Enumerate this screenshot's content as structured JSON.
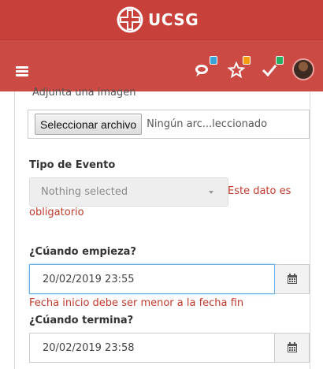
{
  "header": {
    "brand": "UCSG",
    "colors": {
      "topbar": "#c8403a",
      "navbar": "#cc4a44"
    }
  },
  "nav": {
    "icons": [
      {
        "name": "comments-icon",
        "badge_color": "#3aa3d8"
      },
      {
        "name": "star-icon",
        "badge_color": "#f39c12"
      },
      {
        "name": "check-icon",
        "badge_color": "#27ae60"
      }
    ]
  },
  "form": {
    "image_label_cut": "Adjunta una imagen",
    "file_button": "Seleccionar archivo",
    "file_status": "Ningún arc...leccionado",
    "event_type_label": "Tipo de Evento",
    "event_type_placeholder": "Nothing selected",
    "event_type_error_1": "Este dato es",
    "event_type_error_2": "obligatorio",
    "start_label": "¿Cúando empieza?",
    "start_value": "20/02/2019 23:55",
    "start_error": "Fecha inicio debe ser menor a la fecha fin",
    "end_label": "¿Cúando termina?",
    "end_value": "20/02/2019 23:58"
  }
}
